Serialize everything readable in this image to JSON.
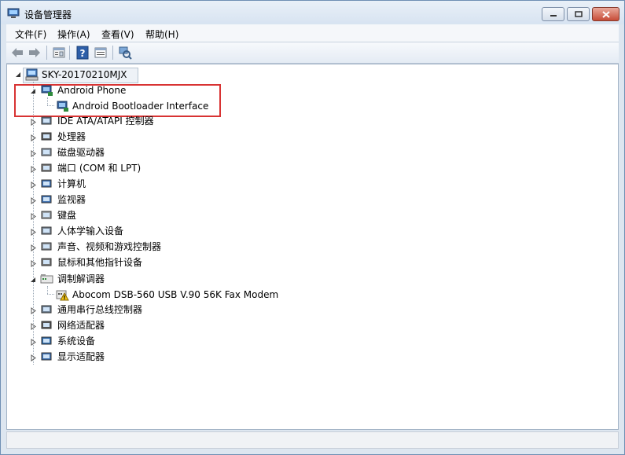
{
  "window": {
    "title": "设备管理器",
    "controls": [
      "minimize",
      "maximize",
      "close"
    ]
  },
  "menu": {
    "items": [
      "文件(F)",
      "操作(A)",
      "查看(V)",
      "帮助(H)"
    ]
  },
  "toolbar": {
    "buttons": [
      "back-icon",
      "forward-icon",
      "properties-icon",
      "help-icon",
      "view-icon",
      "scan-hardware-icon"
    ]
  },
  "tree": {
    "root": "SKY-20170210MJX",
    "nodes": [
      {
        "label": "Android Phone",
        "expanded": true,
        "children": [
          "Android Bootloader Interface"
        ]
      },
      {
        "label": "IDE ATA/ATAPI 控制器",
        "expanded": false
      },
      {
        "label": "处理器",
        "expanded": false
      },
      {
        "label": "磁盘驱动器",
        "expanded": false
      },
      {
        "label": "端口 (COM 和 LPT)",
        "expanded": false
      },
      {
        "label": "计算机",
        "expanded": false
      },
      {
        "label": "监视器",
        "expanded": false
      },
      {
        "label": "键盘",
        "expanded": false
      },
      {
        "label": "人体学输入设备",
        "expanded": false
      },
      {
        "label": "声音、视频和游戏控制器",
        "expanded": false
      },
      {
        "label": "鼠标和其他指针设备",
        "expanded": false
      },
      {
        "label": "调制解调器",
        "expanded": true,
        "children": [
          "Abocom DSB-560 USB V.90 56K Fax Modem"
        ]
      },
      {
        "label": "通用串行总线控制器",
        "expanded": false
      },
      {
        "label": "网络适配器",
        "expanded": false
      },
      {
        "label": "系统设备",
        "expanded": false
      },
      {
        "label": "显示适配器",
        "expanded": false
      }
    ]
  },
  "colors": {
    "highlight_border": "#d83333",
    "window_frame": "#6f8fb4"
  }
}
